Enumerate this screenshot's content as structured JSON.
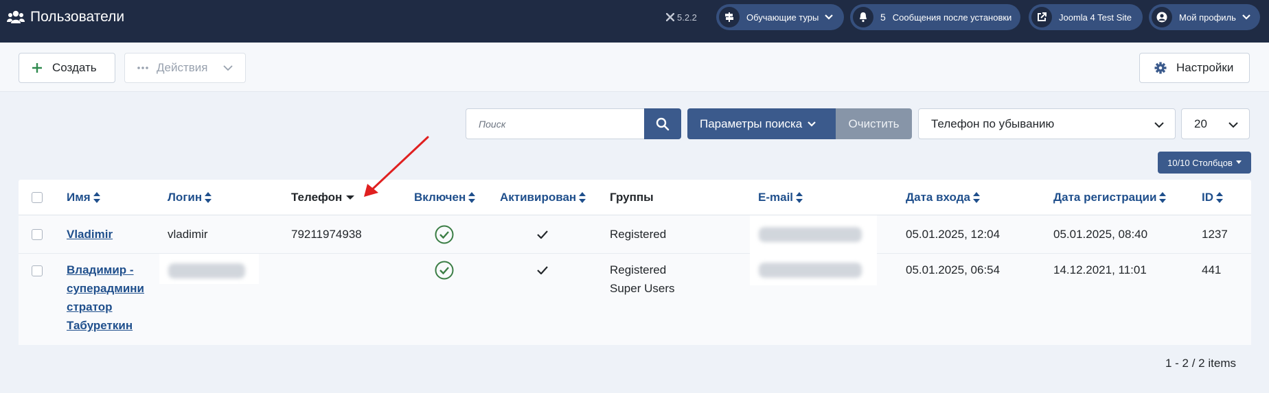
{
  "header": {
    "title": "Пользователи",
    "version": "5.2.2",
    "guided_tours": "Обучающие туры",
    "post_install_count": "5",
    "post_install_label": "Сообщения после установки",
    "site_label": "Joomla 4 Test Site",
    "profile_label": "Мой профиль"
  },
  "toolbar": {
    "create_label": "Создать",
    "actions_label": "Действия",
    "settings_label": "Настройки"
  },
  "filters": {
    "search_placeholder": "Поиск",
    "search_value": "",
    "params_label": "Параметры поиска",
    "clear_label": "Очистить",
    "sort_selected": "Телефон по убыванию",
    "limit_selected": "20",
    "columns_label": "10/10 Столбцов"
  },
  "table": {
    "headers": {
      "name": "Имя",
      "login": "Логин",
      "phone": "Телефон",
      "enabled": "Включен",
      "activated": "Активирован",
      "groups": "Группы",
      "email": "E-mail",
      "last_visit": "Дата входа",
      "registered": "Дата регистрации",
      "id": "ID"
    },
    "rows": [
      {
        "name": "Vladimir",
        "login": "vladimir",
        "phone": "79211974938",
        "groups": [
          "Registered"
        ],
        "last_visit": "05.01.2025, 12:04",
        "registered": "05.01.2025, 08:40",
        "id": "1237"
      },
      {
        "name_lines": [
          "Владимир -",
          "суперадмини",
          "стратор",
          "Табуреткин"
        ],
        "login": "",
        "phone": "",
        "groups": [
          "Registered",
          "Super Users"
        ],
        "last_visit": "05.01.2025, 06:54",
        "registered": "14.12.2021, 11:01",
        "id": "441"
      }
    ]
  },
  "pagination": {
    "summary": "1 - 2 / 2 items"
  },
  "colors": {
    "header_bg": "#1f2b44",
    "pill_bg": "#36507e",
    "primary": "#3b5a8c",
    "link": "#1f4f8c",
    "success": "#3a7d44",
    "annotation_arrow": "#e02020"
  }
}
